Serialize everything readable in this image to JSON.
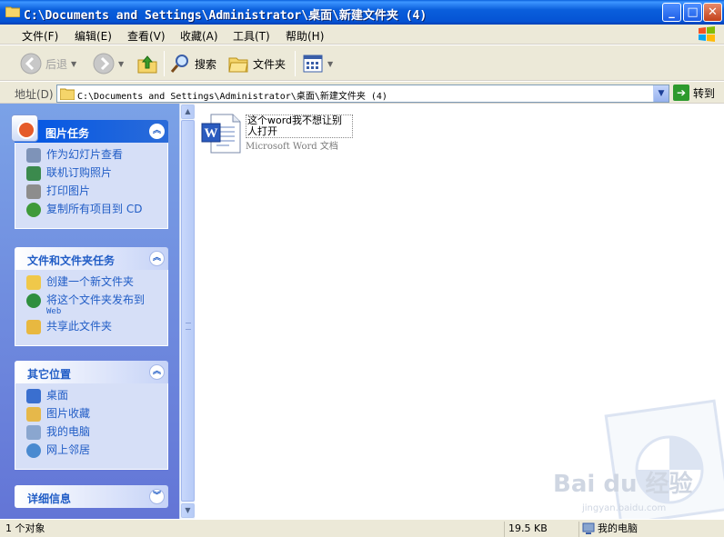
{
  "window": {
    "title": "C:\\Documents and Settings\\Administrator\\桌面\\新建文件夹 (4)",
    "buttons": {
      "minimize": "_",
      "maximize": "□",
      "close": "✕"
    }
  },
  "menu": {
    "items": [
      "文件(F)",
      "编辑(E)",
      "查看(V)",
      "收藏(A)",
      "工具(T)",
      "帮助(H)"
    ]
  },
  "toolbar": {
    "back_label": "后退",
    "search_label": "搜索",
    "folders_label": "文件夹"
  },
  "address": {
    "label": "地址(D)",
    "value": "C:\\Documents and Settings\\Administrator\\桌面\\新建文件夹 (4)",
    "go_label": "转到"
  },
  "sidebar": {
    "panels": [
      {
        "title": "图片任务",
        "tasks": [
          "作为幻灯片查看",
          "联机订购照片",
          "打印图片",
          "复制所有项目到 CD"
        ]
      },
      {
        "title": "文件和文件夹任务",
        "tasks": [
          "创建一个新文件夹",
          "将这个文件夹发布到",
          "共享此文件夹"
        ],
        "task_sub": "Web"
      },
      {
        "title": "其它位置",
        "tasks": [
          "桌面",
          "图片收藏",
          "我的电脑",
          "网上邻居"
        ]
      },
      {
        "title": "详细信息"
      }
    ]
  },
  "files": [
    {
      "name": "这个word我不想让别人打开",
      "type": "Microsoft Word 文档"
    }
  ],
  "watermark": {
    "brand": "Bai du 经验",
    "url": "jingyan.baidu.com"
  },
  "status": {
    "count": "1 个对象",
    "size": "19.5 KB",
    "location": "我的电脑"
  }
}
